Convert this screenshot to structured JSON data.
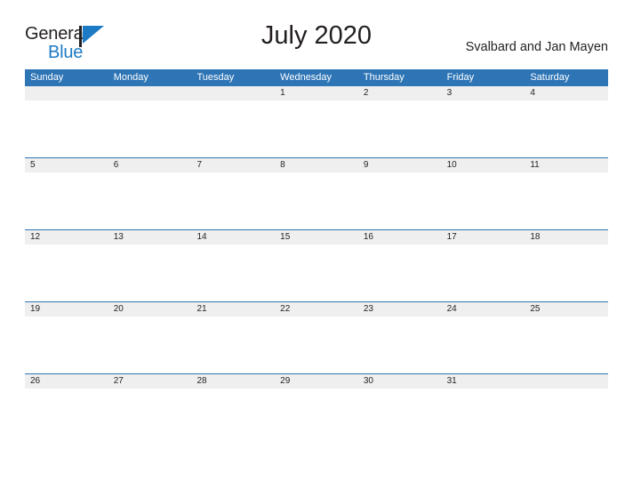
{
  "brand": {
    "name_part1": "General",
    "name_part2": "Blue",
    "flag_color": "#1c7bc4"
  },
  "header": {
    "title": "July 2020",
    "region": "Svalbard and Jan Mayen"
  },
  "theme": {
    "header_blue": "#2e75b6",
    "date_strip_gray": "#efefef",
    "text_dark": "#231f20",
    "background": "#ffffff"
  },
  "calendar": {
    "month": "July",
    "year": "2020",
    "weekdays": [
      "Sunday",
      "Monday",
      "Tuesday",
      "Wednesday",
      "Thursday",
      "Friday",
      "Saturday"
    ],
    "weeks": [
      [
        "",
        "",
        "",
        "1",
        "2",
        "3",
        "4"
      ],
      [
        "5",
        "6",
        "7",
        "8",
        "9",
        "10",
        "11"
      ],
      [
        "12",
        "13",
        "14",
        "15",
        "16",
        "17",
        "18"
      ],
      [
        "19",
        "20",
        "21",
        "22",
        "23",
        "24",
        "25"
      ],
      [
        "26",
        "27",
        "28",
        "29",
        "30",
        "31",
        ""
      ]
    ]
  }
}
